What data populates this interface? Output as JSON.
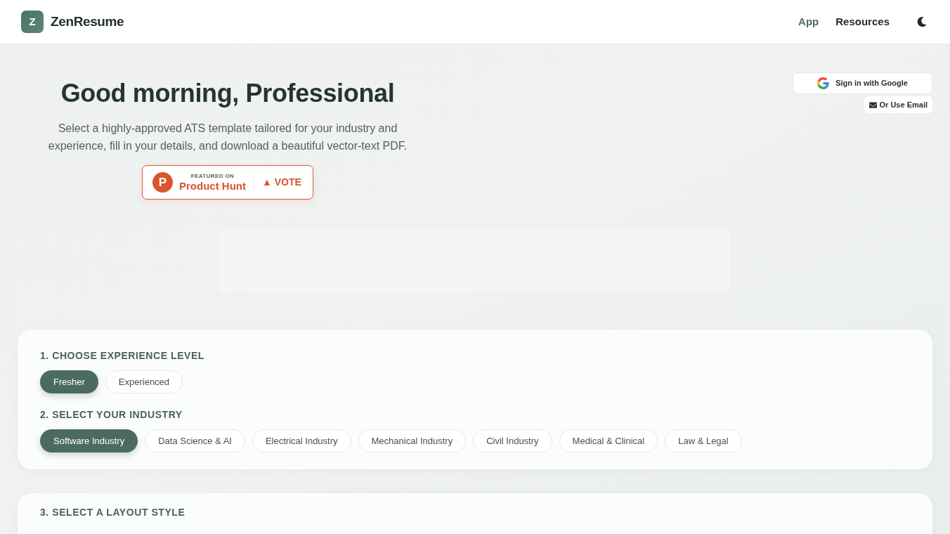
{
  "header": {
    "logo_letter": "Z",
    "brand": "ZenResume",
    "nav": [
      {
        "label": "App",
        "selected": true
      },
      {
        "label": "Resources",
        "selected": false
      }
    ]
  },
  "auth": {
    "google_button": "Sign in with Google",
    "email_button": "Or Use Email"
  },
  "hero": {
    "title": "Good morning, Professional",
    "subtitle": "Select a highly-approved ATS template tailored for your industry and experience, fill in your details, and download a beautiful vector-text PDF.",
    "badge": {
      "logo_letter": "P",
      "kicker": "FEATURED ON",
      "name": "Product Hunt",
      "vote": "▲ VOTE"
    }
  },
  "sections": [
    {
      "heading": "1. CHOOSE EXPERIENCE LEVEL",
      "options": [
        {
          "label": "Fresher",
          "selected": true
        },
        {
          "label": "Experienced",
          "selected": false
        }
      ]
    },
    {
      "heading": "2. SELECT YOUR INDUSTRY",
      "options": [
        {
          "label": "Software Industry",
          "selected": true
        },
        {
          "label": "Data Science & AI",
          "selected": false
        },
        {
          "label": "Electrical Industry",
          "selected": false
        },
        {
          "label": "Mechanical Industry",
          "selected": false
        },
        {
          "label": "Civil Industry",
          "selected": false
        },
        {
          "label": "Medical & Clinical",
          "selected": false
        },
        {
          "label": "Law & Legal",
          "selected": false
        }
      ]
    }
  ],
  "layout_section": {
    "heading": "3. SELECT A LAYOUT STYLE"
  }
}
